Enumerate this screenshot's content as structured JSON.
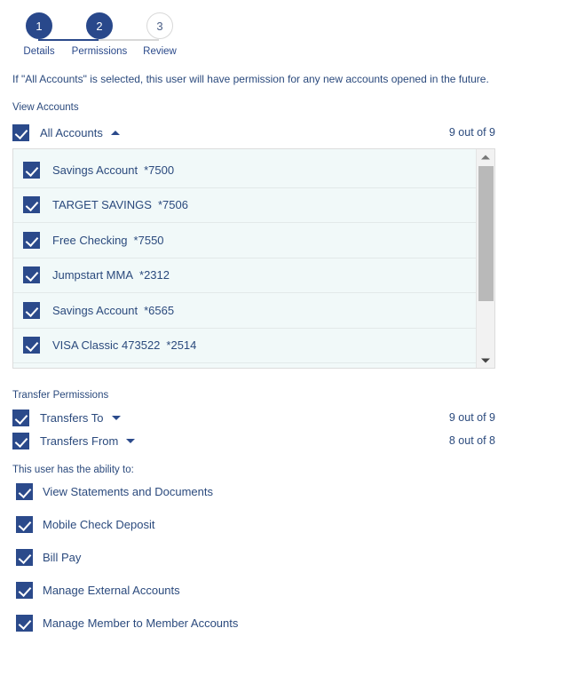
{
  "stepper": {
    "steps": [
      {
        "number": "1",
        "label": "Details",
        "state": "filled"
      },
      {
        "number": "2",
        "label": "Permissions",
        "state": "filled"
      },
      {
        "number": "3",
        "label": "Review",
        "state": "hollow"
      }
    ]
  },
  "intro": {
    "text": "If \"All Accounts\" is selected, this user will have permission for any new accounts opened in the future."
  },
  "view_accounts": {
    "section_label": "View Accounts",
    "all_accounts_label": "All Accounts",
    "all_accounts_caret": "chevron-up-icon",
    "all_accounts_count": "9 out of 9",
    "accounts": [
      {
        "name": "Savings Account",
        "number": "*7500",
        "checked": true
      },
      {
        "name": "TARGET SAVINGS",
        "number": "*7506",
        "checked": true
      },
      {
        "name": "Free Checking",
        "number": "*7550",
        "checked": true
      },
      {
        "name": "Jumpstart MMA",
        "number": "*2312",
        "checked": true
      },
      {
        "name": "Savings Account",
        "number": "*6565",
        "checked": true
      },
      {
        "name": "VISA Classic 473522",
        "number": "*2514",
        "checked": true
      }
    ]
  },
  "transfer_permissions": {
    "section_label": "Transfer Permissions",
    "rows": [
      {
        "label": "Transfers To",
        "caret": "chevron-down-icon",
        "count": "9 out of 9",
        "checked": true
      },
      {
        "label": "Transfers From",
        "caret": "chevron-down-icon",
        "count": "8 out of 8",
        "checked": true
      }
    ]
  },
  "abilities": {
    "section_label": "This user has the ability to:",
    "items": [
      {
        "label": "View Statements and Documents",
        "checked": true
      },
      {
        "label": "Mobile Check Deposit",
        "checked": true
      },
      {
        "label": "Bill Pay",
        "checked": true
      },
      {
        "label": "Manage External Accounts",
        "checked": true
      },
      {
        "label": "Manage Member to Member Accounts",
        "checked": true
      }
    ]
  },
  "colors": {
    "accent": "#2b4a8b",
    "text": "#2b4a7d",
    "list_bg": "#f1f9f9",
    "track_done": "#2b4a8b",
    "track_todo": "#d8d8d8"
  }
}
